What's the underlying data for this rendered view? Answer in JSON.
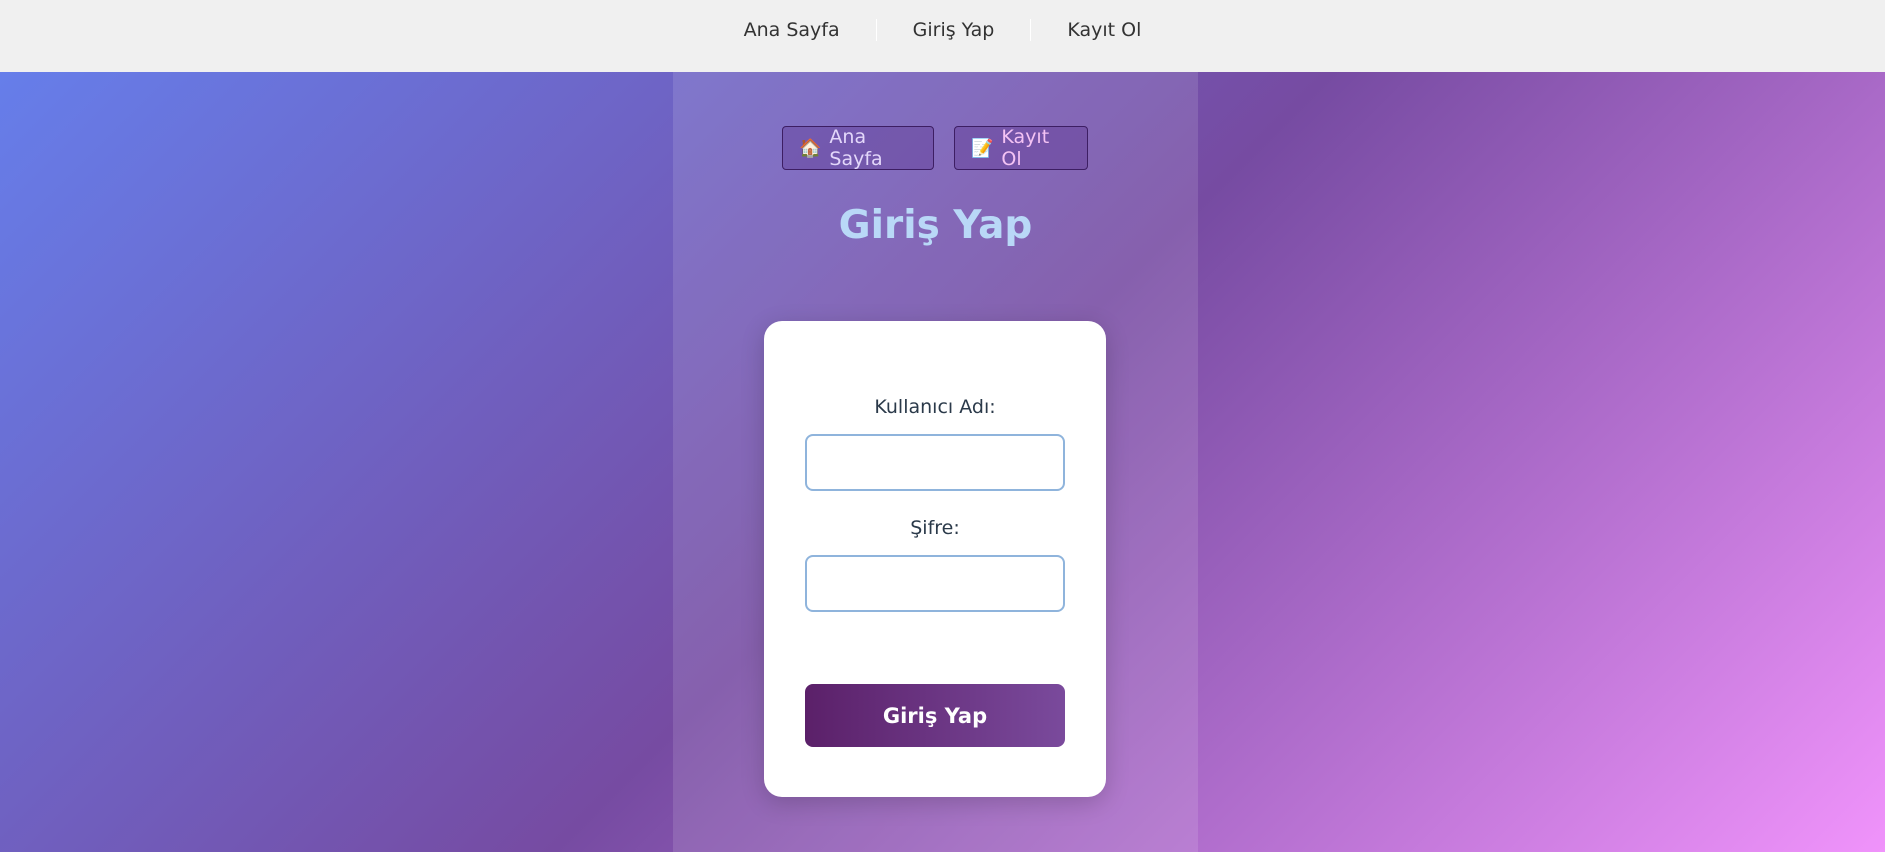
{
  "topnav": {
    "links": [
      {
        "label": "Ana Sayfa"
      },
      {
        "label": "Giriş Yap"
      },
      {
        "label": "Kayıt Ol"
      }
    ]
  },
  "pills": {
    "home": {
      "icon": "🏠",
      "icon_name": "house-icon",
      "label": "Ana Sayfa"
    },
    "register": {
      "icon": "📝",
      "icon_name": "memo-icon",
      "label": "Kayıt Ol"
    }
  },
  "page_title": "Giriş Yap",
  "form": {
    "username_label": "Kullanıcı Adı:",
    "username_value": "",
    "password_label": "Şifre:",
    "password_value": "",
    "submit_label": "Giriş Yap"
  },
  "colors": {
    "gradient_start": "#667eea",
    "gradient_mid": "#764ba2",
    "gradient_end": "#f093fb",
    "title": "#b9d8f7",
    "button": "#5b2069",
    "field_border": "#8fb4dc"
  }
}
